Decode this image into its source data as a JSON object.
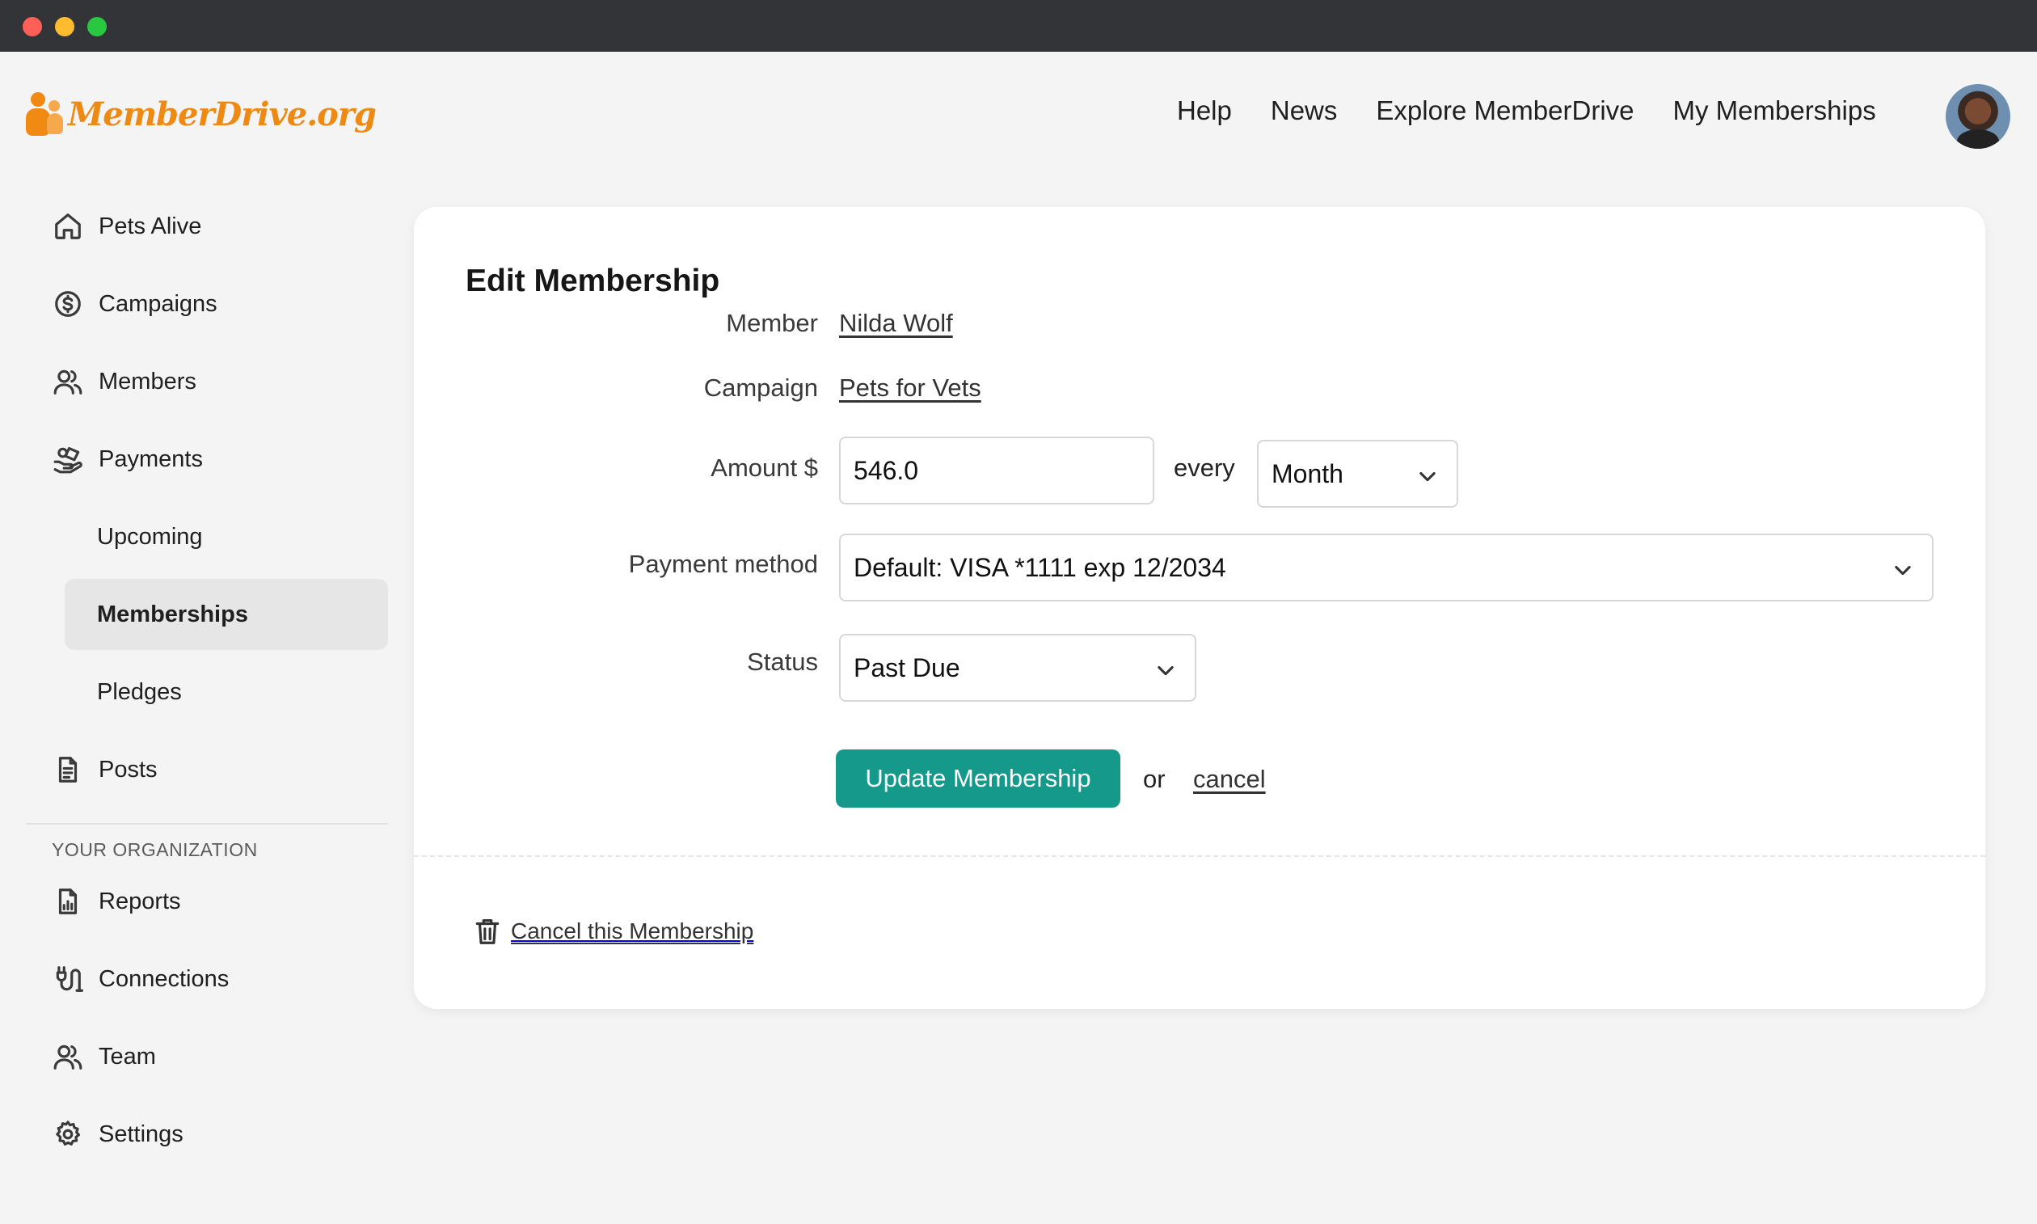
{
  "window": {
    "title": ""
  },
  "brand": {
    "name": "MemberDrive.org"
  },
  "topnav": {
    "items": [
      "Help",
      "News",
      "Explore MemberDrive",
      "My Memberships"
    ]
  },
  "sidebar": {
    "items": [
      {
        "label": "Pets Alive",
        "icon": "home-icon"
      },
      {
        "label": "Campaigns",
        "icon": "dollar-circle-icon"
      },
      {
        "label": "Members",
        "icon": "users-icon"
      },
      {
        "label": "Payments",
        "icon": "payments-icon"
      },
      {
        "label": "Upcoming",
        "icon": ""
      },
      {
        "label": "Memberships",
        "icon": "",
        "active": true
      },
      {
        "label": "Pledges",
        "icon": ""
      },
      {
        "label": "Posts",
        "icon": "document-icon"
      }
    ],
    "section_label": "YOUR ORGANIZATION",
    "org_items": [
      {
        "label": "Reports",
        "icon": "report-icon"
      },
      {
        "label": "Connections",
        "icon": "plug-icon"
      },
      {
        "label": "Team",
        "icon": "users-icon"
      },
      {
        "label": "Settings",
        "icon": "gear-icon"
      }
    ]
  },
  "form": {
    "title": "Edit Membership",
    "member_label": "Member",
    "member_value": "Nilda Wolf",
    "campaign_label": "Campaign",
    "campaign_value": "Pets for Vets",
    "amount_label": "Amount $",
    "amount_value": "546.0",
    "every_text": "every",
    "frequency_value": "Month",
    "payment_label": "Payment method",
    "payment_value": "Default: VISA *1111 exp 12/2034",
    "status_label": "Status",
    "status_value": "Past Due",
    "submit_label": "Update Membership",
    "or_text": "or",
    "cancel_label": "cancel",
    "cancel_membership_label": "Cancel this Membership"
  },
  "colors": {
    "accent": "#14998a",
    "brand": "#ee8a14",
    "titlebar": "#333437"
  }
}
